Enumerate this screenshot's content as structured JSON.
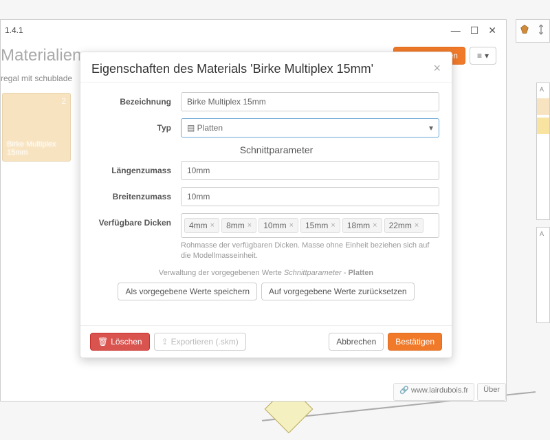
{
  "window": {
    "version": "1.4.1"
  },
  "header": {
    "title": "Materialien",
    "refresh": "Aktualisieren",
    "menu": "≡"
  },
  "breadcrumb": "regal mit schublade",
  "material_card": {
    "name": "Birke Multiplex 15mm",
    "count": "2"
  },
  "footer": {
    "link": "www.lairdubois.fr",
    "about": "Über"
  },
  "modal": {
    "title": "Eigenschaften des Materials 'Birke Multiplex 15mm'",
    "labels": {
      "name": "Bezeichnung",
      "type": "Typ",
      "section": "Schnittparameter",
      "length_allow": "Längenzumass",
      "width_allow": "Breitenzumass",
      "thicknesses": "Verfügbare Dicken"
    },
    "values": {
      "name": "Birke Multiplex 15mm",
      "type": "Platten",
      "length_allow": "10mm",
      "width_allow": "10mm"
    },
    "thicknesses": [
      "4mm",
      "8mm",
      "10mm",
      "15mm",
      "18mm",
      "22mm"
    ],
    "help_thickness": "Rohmasse der verfügbaren Dicken. Masse ohne Einheit beziehen sich auf die Modellmasseinheit.",
    "defaults_line_a": "Verwaltung der vorgegebenen Werte",
    "defaults_line_b": "Schnittparameter",
    "defaults_line_c": "Platten",
    "save_defaults": "Als vorgegebene Werte speichern",
    "reset_defaults": "Auf vorgegebene Werte zurücksetzen",
    "buttons": {
      "delete": "Löschen",
      "export": "Exportieren (.skm)",
      "cancel": "Abbrechen",
      "confirm": "Bestätigen"
    }
  }
}
